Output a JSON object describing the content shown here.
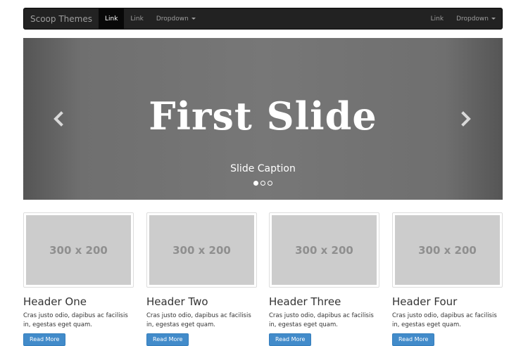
{
  "navbar": {
    "brand": "Scoop Themes",
    "left_items": [
      {
        "label": "Link",
        "active": true
      },
      {
        "label": "Link",
        "active": false
      },
      {
        "label": "Dropdown",
        "active": false
      }
    ],
    "right_items": [
      {
        "label": "Link"
      },
      {
        "label": "Dropdown"
      }
    ]
  },
  "carousel": {
    "title": "First Slide",
    "caption": "Slide Caption",
    "indicator_count": 3,
    "active_indicator": 1,
    "prev_icon": "chevron-left-icon",
    "next_icon": "chevron-right-icon"
  },
  "cards": [
    {
      "image_text": "300 x 200",
      "title": "Header One",
      "text": "Cras justo odio, dapibus ac facilisis in, egestas eget quam.",
      "button": "Read More"
    },
    {
      "image_text": "300 x 200",
      "title": "Header Two",
      "text": "Cras justo odio, dapibus ac facilisis in, egestas eget quam.",
      "button": "Read More"
    },
    {
      "image_text": "300 x 200",
      "title": "Header Three",
      "text": "Cras justo odio, dapibus ac facilisis in, egestas eget quam.",
      "button": "Read More"
    },
    {
      "image_text": "300 x 200",
      "title": "Header Four",
      "text": "Cras justo odio, dapibus ac facilisis in, egestas eget quam.",
      "button": "Read More"
    }
  ],
  "colors": {
    "navbar_bg": "#222222",
    "nav_active_bg": "#080808",
    "button_primary": "#428bca",
    "placeholder_bg": "#cccccc"
  }
}
